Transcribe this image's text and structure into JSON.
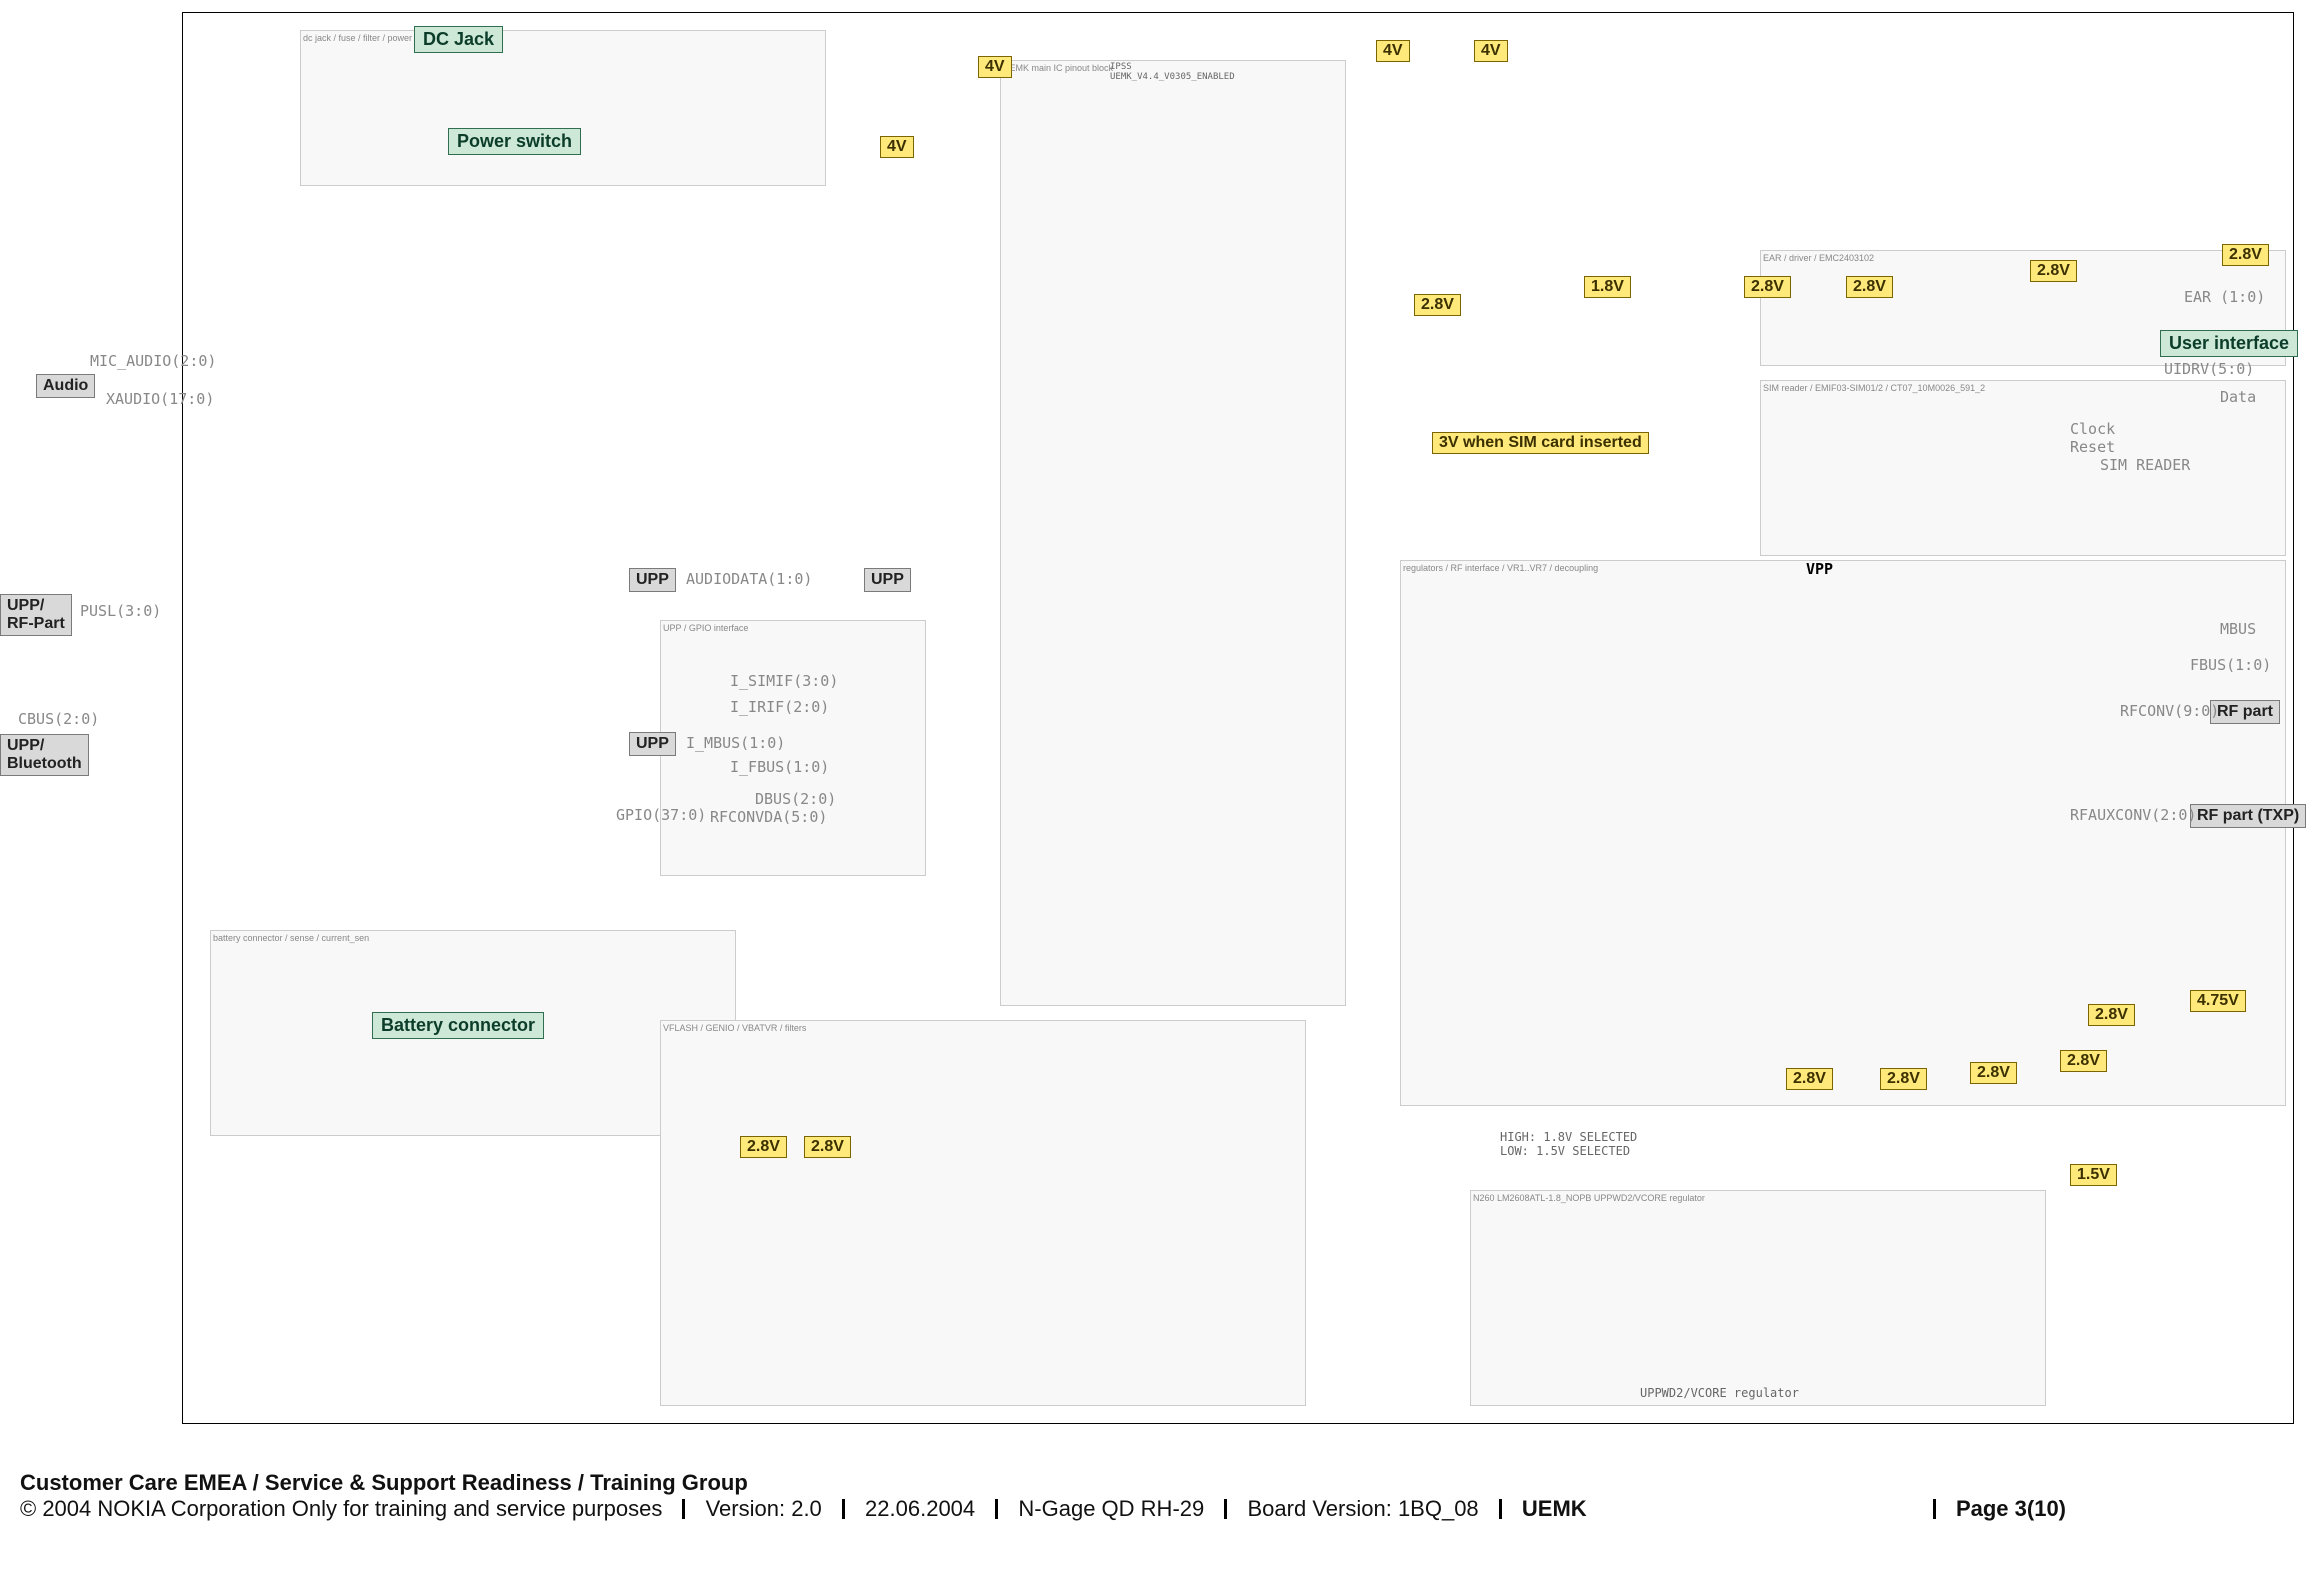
{
  "labels_green": {
    "dc_jack": "DC Jack",
    "power_switch": "Power switch",
    "user_interface": "User interface",
    "battery_connector": "Battery connector"
  },
  "labels_yellow": {
    "v4_1": "4V",
    "v4_2": "4V",
    "v4_3": "4V",
    "v4_4": "4V",
    "v28_a": "2.8V",
    "v28_b": "2.8V",
    "v28_c": "2.8V",
    "v28_d": "2.8V",
    "v28_e": "2.8V",
    "v18": "1.8V",
    "sim3v": "3V when SIM card inserted",
    "v28_f": "2.8V",
    "v28_g": "2.8V",
    "v28_h": "2.8V",
    "v28_i": "2.8V",
    "v28_j": "2.8V",
    "v28_k": "2.8V",
    "v28_l": "2.8V",
    "v475": "4.75V",
    "v15": "1.5V"
  },
  "labels_gray": {
    "audio": "Audio",
    "upp_rf": "UPP/\nRF-Part",
    "upp_bt": "UPP/\nBluetooth",
    "upp1": "UPP",
    "upp2": "UPP",
    "upp3": "UPP",
    "rf_part": "RF part",
    "rf_txp": "RF part (TXP)"
  },
  "busses": {
    "mic_audio": "MIC_AUDIO(2:0)",
    "xaudio": "XAUDIO(17:0)",
    "pusl": "PUSL(3:0)",
    "cbus": "CBUS(2:0)",
    "audiodata": "AUDIODATA(1:0)",
    "isimif": "I_SIMIF(3:0)",
    "iirif": "I_IRIF(2:0)",
    "imbus": "I_MBUS(1:0)",
    "ifbus": "I_FBUS(1:0)",
    "dbus": "DBUS(2:0)",
    "rfconvda": "RFCONVDA(5:0)",
    "gpio": "GPIO(37:0)",
    "uidrv": "UIDRV(5:0)",
    "mbus": "MBUS",
    "fbus": "FBUS(1:0)",
    "rfconv": "RFCONV(9:0)",
    "rfauxconv": "RFAUXCONV(2:0)",
    "vpp": "VPP",
    "data": "Data",
    "clock": "Clock",
    "reset": "Reset",
    "sim_reader": "SIM READER",
    "ear": "EAR (1:0)"
  },
  "notes": {
    "hilow": "HIGH: 1.8V SELECTED\nLOW: 1.5V SELECTED",
    "reg": "UPPWD2/VCORE regulator",
    "ipss": "IPSS\nUEMK_V4.4_V0305_ENABLED"
  },
  "footer": {
    "line1": "Customer Care EMEA / Service & Support Readiness / Training Group",
    "line2a": "© 2004 NOKIA Corporation  Only for training and service purposes",
    "version_lbl": "Version:",
    "version": "2.0",
    "date": "22.06.2004",
    "product": "N-Gage QD RH-29",
    "board_lbl": "Board Version:",
    "board": "1BQ_08",
    "block": "UEMK",
    "page": "Page 3(10)"
  }
}
